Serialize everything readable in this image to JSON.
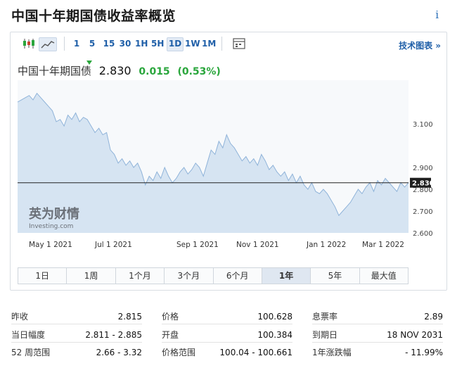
{
  "page": {
    "title": "中国十年期国债收益率概览",
    "info_glyph": "i"
  },
  "toolbar": {
    "intervals": [
      "1",
      "5",
      "15",
      "30",
      "1H",
      "5H",
      "1D",
      "1W",
      "1M"
    ],
    "active_interval": "1D",
    "tech_link": "技术图表 »",
    "icons": [
      "candlestick-icon",
      "line-chart-icon",
      "calendar-icon"
    ]
  },
  "quote": {
    "name": "中国十年期国债",
    "price": "2.830",
    "change": "0.015",
    "change_pct": "(0.53%)",
    "accent": "#2aa63c"
  },
  "chart_data": {
    "type": "area",
    "title": "",
    "xlabel": "",
    "ylabel": "",
    "x_ticks": [
      "May 1 2021",
      "Jul 1 2021",
      "Sep 1 2021",
      "Nov 1 2021",
      "Jan 1 2022",
      "Mar 1 2022"
    ],
    "y_ticks": [
      "3.100",
      "2.900",
      "2.800",
      "2.700",
      "2.600"
    ],
    "ylim": [
      2.6,
      3.3
    ],
    "current_value": 2.83,
    "current_label": "2.830",
    "series": [
      {
        "values": [
          3.2,
          3.21,
          3.22,
          3.23,
          3.21,
          3.24,
          3.22,
          3.2,
          3.18,
          3.16,
          3.11,
          3.12,
          3.09,
          3.14,
          3.12,
          3.15,
          3.11,
          3.13,
          3.12,
          3.09,
          3.06,
          3.08,
          3.05,
          3.06,
          2.98,
          2.96,
          2.92,
          2.94,
          2.91,
          2.93,
          2.9,
          2.92,
          2.88,
          2.82,
          2.86,
          2.84,
          2.88,
          2.85,
          2.9,
          2.86,
          2.83,
          2.85,
          2.88,
          2.9,
          2.87,
          2.89,
          2.92,
          2.9,
          2.86,
          2.92,
          2.98,
          2.96,
          3.02,
          2.99,
          3.05,
          3.01,
          2.99,
          2.96,
          2.93,
          2.95,
          2.92,
          2.94,
          2.91,
          2.96,
          2.93,
          2.89,
          2.91,
          2.88,
          2.86,
          2.88,
          2.84,
          2.87,
          2.83,
          2.86,
          2.82,
          2.8,
          2.83,
          2.79,
          2.78,
          2.8,
          2.78,
          2.75,
          2.72,
          2.68,
          2.7,
          2.72,
          2.74,
          2.77,
          2.8,
          2.78,
          2.81,
          2.83,
          2.79,
          2.84,
          2.82,
          2.85,
          2.83,
          2.81,
          2.79,
          2.83,
          2.81,
          2.83
        ]
      }
    ],
    "area_color": "#d6e4f2",
    "line_color": "#8fb3d9"
  },
  "watermark": {
    "cn": "英为财情",
    "en": "Investing.com"
  },
  "ranges": [
    "1日",
    "1周",
    "1个月",
    "3个月",
    "6个月",
    "1年",
    "5年",
    "最大值"
  ],
  "active_range": "1年",
  "stats": [
    [
      {
        "label": "昨收",
        "value": "2.815"
      },
      {
        "label": "价格",
        "value": "100.628"
      },
      {
        "label": "息票率",
        "value": "2.89"
      }
    ],
    [
      {
        "label": "当日幅度",
        "value": "2.811 - 2.885"
      },
      {
        "label": "开盘",
        "value": "100.384"
      },
      {
        "label": "到期日",
        "value": "18 NOV 2031"
      }
    ],
    [
      {
        "label": "52 周范围",
        "value": "2.66 - 3.32"
      },
      {
        "label": "价格范围",
        "value": "100.04 - 100.661"
      },
      {
        "label": "1年涨跌幅",
        "value": "- 11.99%"
      }
    ]
  ]
}
